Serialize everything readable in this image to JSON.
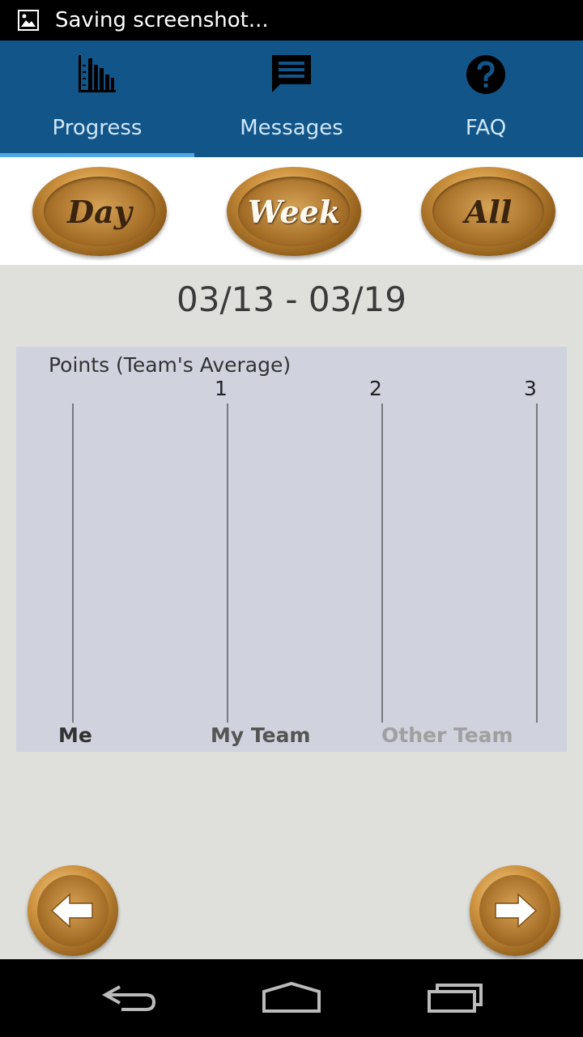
{
  "status_bar": {
    "notification_icon": "image-icon",
    "text": "Saving screenshot..."
  },
  "tabs": [
    {
      "label": "Progress",
      "icon": "bar-chart-icon",
      "active": true
    },
    {
      "label": "Messages",
      "icon": "message-icon",
      "active": false
    },
    {
      "label": "FAQ",
      "icon": "question-icon",
      "active": false
    }
  ],
  "period_buttons": [
    {
      "label": "Day"
    },
    {
      "label": "Week"
    },
    {
      "label": "All"
    }
  ],
  "date_range": "03/13 - 03/19",
  "chart_data": {
    "type": "bar",
    "orientation": "horizontal",
    "title": "Points (Team's Average)",
    "categories": [
      "Me",
      "My Team",
      "Other Team"
    ],
    "values": [
      0,
      0,
      0
    ],
    "x_ticks": [
      "1",
      "2",
      "3"
    ],
    "xlim": [
      0,
      3
    ],
    "grid": true,
    "category_colors": [
      "#333333",
      "#555555",
      "#a0a0a0"
    ]
  },
  "nav": {
    "prev_icon": "arrow-left-icon",
    "next_icon": "arrow-right-icon"
  },
  "system_nav": {
    "back_icon": "back-icon",
    "home_icon": "home-icon",
    "recents_icon": "recents-icon"
  },
  "colors": {
    "tab_bar": "#125589",
    "tab_indicator": "#4ea8e4",
    "chart_background": "#d0d2de",
    "page_background": "#dfe0dc"
  }
}
